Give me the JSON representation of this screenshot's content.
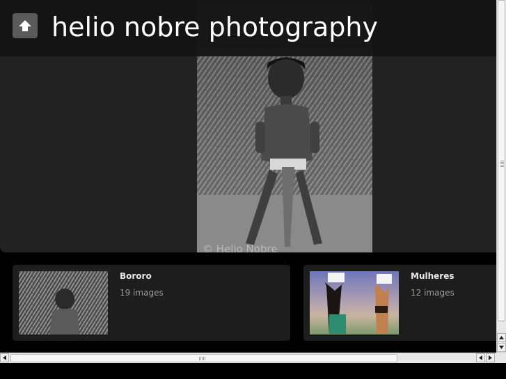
{
  "header": {
    "title": "helio nobre photography",
    "up_icon": "arrow-up-icon"
  },
  "hero": {
    "credit": "© Helio Nobre"
  },
  "albums": [
    {
      "name": "Bororo",
      "count": "19 images"
    },
    {
      "name": "Mulheres",
      "count": "12 images"
    }
  ],
  "colors": {
    "topbar": "#141414",
    "hero_bg": "#222222",
    "card_bg": "#1d1d1d",
    "up_button": "#5a5a5a"
  }
}
